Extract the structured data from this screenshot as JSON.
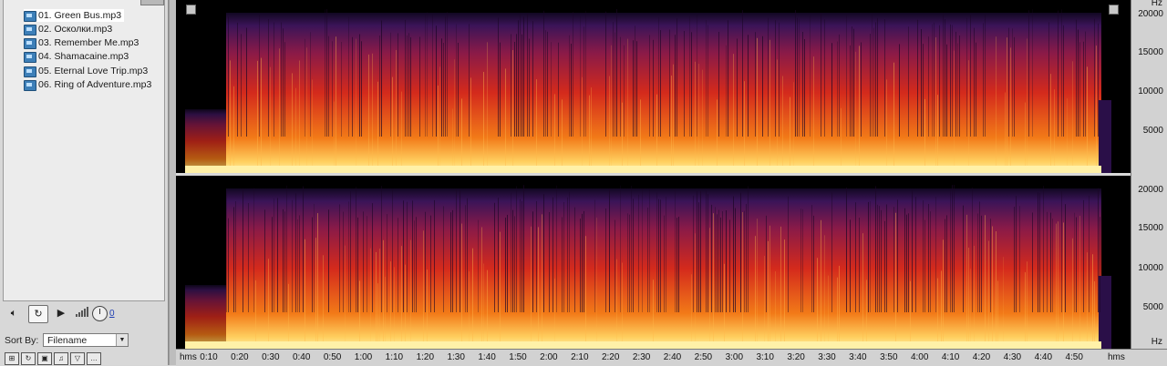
{
  "file_list": {
    "items": [
      {
        "label": "01. Green Bus.mp3",
        "selected": true
      },
      {
        "label": "02. Осколки.mp3",
        "selected": false
      },
      {
        "label": "03. Remember Me.mp3",
        "selected": false
      },
      {
        "label": "04. Shamacaine.mp3",
        "selected": false
      },
      {
        "label": "05. Eternal Love Trip.mp3",
        "selected": false
      },
      {
        "label": "06. Ring of Adventure.mp3",
        "selected": false
      }
    ]
  },
  "transport": {
    "volume_value": "0"
  },
  "sort": {
    "label": "Sort By:",
    "selected": "Filename"
  },
  "freq_axis": {
    "unit": "Hz",
    "ticks": [
      "20000",
      "15000",
      "10000",
      "5000"
    ]
  },
  "time_axis": {
    "unit": "hms",
    "labels": [
      "0:10",
      "0:20",
      "0:30",
      "0:40",
      "0:50",
      "1:00",
      "1:10",
      "1:20",
      "1:30",
      "1:40",
      "1:50",
      "2:00",
      "2:10",
      "2:20",
      "2:30",
      "2:40",
      "2:50",
      "3:00",
      "3:10",
      "3:20",
      "3:30",
      "3:40",
      "3:50",
      "4:00",
      "4:10",
      "4:20",
      "4:30",
      "4:40",
      "4:50"
    ]
  },
  "colors": {
    "spectrum_low": "#1a0a2e",
    "spectrum_mid": "#c8191e",
    "spectrum_high": "#ffd45a",
    "background": "#000000"
  }
}
